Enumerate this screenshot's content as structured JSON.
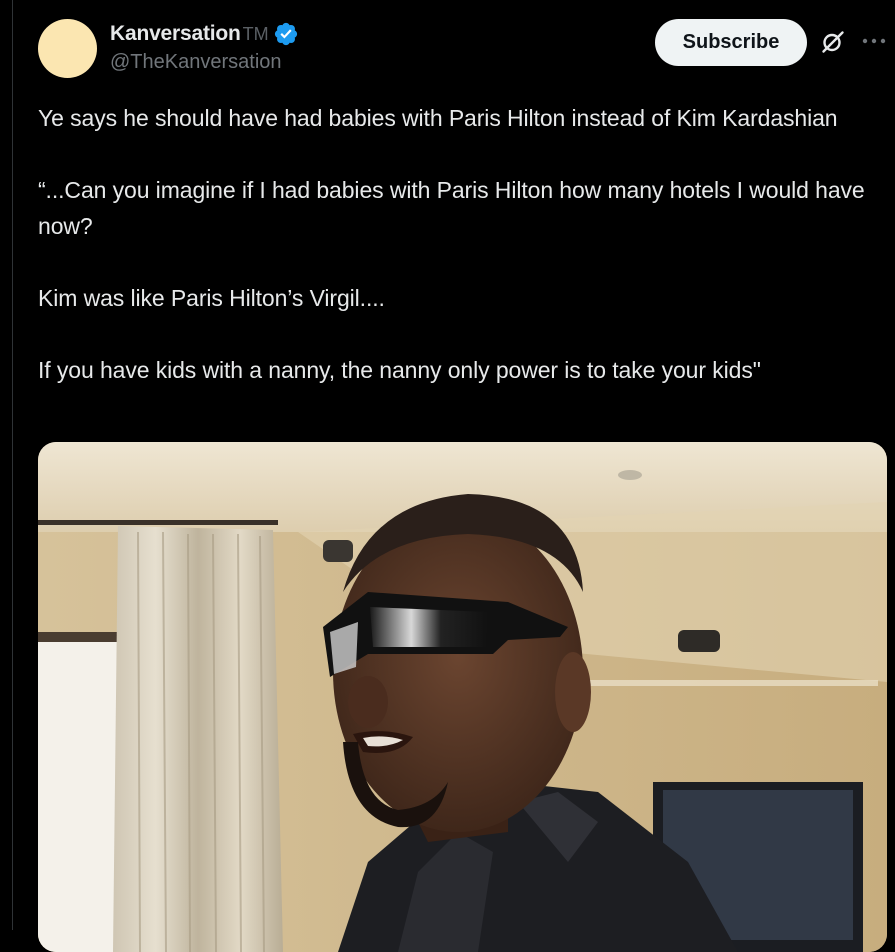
{
  "author": {
    "display_name": "Kanversation",
    "tm_mark": "TM",
    "handle": "@TheKanversation",
    "verified": true,
    "avatar_color": "#fbe6b1",
    "verified_color": "#1d9bf0"
  },
  "actions": {
    "subscribe_label": "Subscribe",
    "grok_icon": "grok-icon",
    "more_icon": "more-icon"
  },
  "tweet": {
    "paragraphs": [
      "Ye says he should have had babies with Paris Hilton instead of Kim Kardashian",
      "“...Can you imagine if I had babies with Paris Hilton how many hotels I would have now?",
      "Kim was like Paris Hilton’s Virgil....",
      "If you have kids with a nanny, the nanny only power is to take your kids\""
    ]
  },
  "media": {
    "type": "video-frame",
    "description_icon": "media-photo"
  },
  "colors": {
    "background": "#000000",
    "text": "#e7e9ea",
    "secondary_text": "#71767b",
    "subscribe_bg": "#eff3f4"
  }
}
